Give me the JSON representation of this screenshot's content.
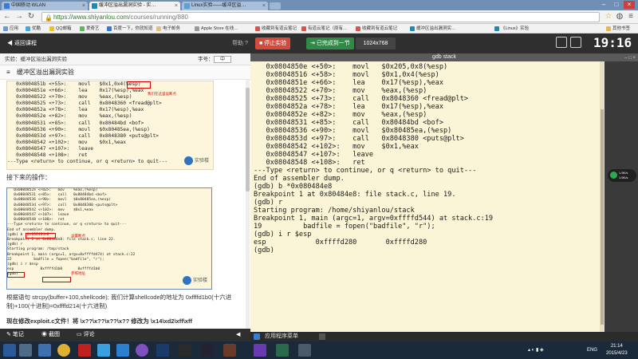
{
  "browser": {
    "tabs": [
      {
        "label": "中国移动 WLAN",
        "active": false
      },
      {
        "label": "缓冲区溢出漏洞实验 - 实…",
        "active": true
      },
      {
        "label": "Linux实验——缓冲区溢…",
        "active": false
      }
    ],
    "url_host": "https://www.shiyanlou.com",
    "url_path": "/courses/running/880",
    "bookmarks": [
      "应用",
      "优酷",
      "QQ邮箱",
      "爱奇艺",
      "百度一下，你就知道",
      "电子邮务",
      "Apple Store 在线…",
      "收藏到有道云笔记",
      "有道云笔记（原有…",
      "收藏到有道云笔记",
      "缓冲区溢出漏洞实…",
      "《Linux》实验",
      "其他书签"
    ]
  },
  "toolbar": {
    "back_label": "返回课程",
    "help_label": "帮助",
    "stop_label": "停止实验",
    "next_label": "已完成到一节",
    "resolution": "1024x768",
    "clock": "19:16"
  },
  "left_panel": {
    "header": "实验：缓冲区溢出漏洞实验",
    "font_label": "字号：",
    "font_value": "中",
    "section_title": "缓冲区溢出漏洞实验",
    "shot1_lines": [
      "   0x0804851b <+55>:    movl   $0x1,0x4(%esp)",
      "   0x0804851e <+66>:    lea    0x17(%esp),%eax",
      "   0x08048522 <+70>:    mov    %eax,(%esp)",
      "   0x08048525 <+73>:    call   0x8048360 <fread@plt>",
      "   0x0804852a <+78>:    lea    0x17(%esp),%eax",
      "   0x0804852e <+82>:    mov    %eax,(%esp)",
      "   0x08048531 <+85>:    call   0x80484bd <bof>",
      "   0x08048536 <+90>:    movl   $0x80485ea,(%esp)",
      "   0x0804853d <+97>:    call   0x8048380 <puts@plt>",
      "   0x08048542 <+102>:   mov    $0x1,%eax",
      "   0x08048547 <+107>:   leave",
      "   0x08048548 <+108>:   ret",
      "---Type <return> to continue, or q <return> to quit---"
    ],
    "shot1_annot": "我们在这里设断点",
    "shot1_logo": "实验楼",
    "shot2_caption": "接下来的操作：",
    "shot2_lines": [
      "   0x0804852e <+82>:   mov    %eax,(%esp)",
      "   0x08048531 <+85>:   call   0x80484bd <bof>",
      "   0x08048536 <+90>:   movl   $0x80485ea,(%esp)",
      "   0x0804853d <+97>:   call   0x8048380 <puts@plt>",
      "   0x08048542 <+102>:  mov    $0x1,%eax",
      "   0x08048547 <+107>:  leave",
      "   0x08048548 <+108>:  ret",
      "---Type <return> to continue, or q <return> to quit---",
      "End of assembler dump.",
      "(gdb) b *0x080484e8",
      "Breakpoint 1 at 0x80484e8: file stack.c, line 22.",
      "(gdb) r",
      "Starting program: /tmp/stack",
      "",
      "Breakpoint 1, main (argc=1, argv=0xffffd474) at stack.c:22",
      "22          badfile = fopen(\"badfile\", \"r\");",
      "(gdb) i r $esp",
      "esp            0xffffd1b0       0xffffd1b0",
      "(gdb) "
    ],
    "shot2_annot1": "设置断点",
    "shot2_annot2": "esp",
    "shot2_annot3": "参照地址",
    "para1": "根据语句 strcpy(buffer+100,shellcode); 我们计算shellcode的地址为 0xffffd1b0(十六进制)+100(十进制)=0xffffd214(十六进制)",
    "para2": "现在修改exploit.c文件！将 \\x??\\x??\\x??\\x?? 修改为 \\x14\\xd2\\xff\\xff",
    "footer": [
      "笔记",
      "截图",
      "评论"
    ]
  },
  "terminal": {
    "title": "gdb stack",
    "lines": [
      "   0x0804850e <+50>:    movl   $0x205,0x8(%esp)",
      "   0x08048516 <+58>:    movl   $0x1,0x4(%esp)",
      "   0x0804851e <+66>:    lea    0x17(%esp),%eax",
      "   0x08048522 <+70>:    mov    %eax,(%esp)",
      "   0x08048525 <+73>:    call   0x8048360 <fread@plt>",
      "   0x0804852a <+78>:    lea    0x17(%esp),%eax",
      "   0x0804852e <+82>:    mov    %eax,(%esp)",
      "   0x08048531 <+85>:    call   0x80484bd <bof>",
      "   0x08048536 <+90>:    movl   $0x80485ea,(%esp)",
      "   0x0804853d <+97>:    call   0x8048380 <puts@plt>",
      "   0x08048542 <+102>:   mov    $0x1,%eax",
      "   0x08048547 <+107>:   leave",
      "   0x08048548 <+108>:   ret",
      "---Type <return> to continue, or q <return> to quit---",
      "End of assembler dump.",
      "(gdb) b *0x080484e8",
      "Breakpoint 1 at 0x80484e8: file stack.c, line 19.",
      "(gdb) r",
      "Starting program: /home/shiyanlou/stack",
      "",
      "Breakpoint 1, main (argc=1, argv=0xffffd544) at stack.c:19",
      "19          badfile = fopen(\"badfile\", \"r\");",
      "(gdb) i r $esp",
      "esp            0xffffd280       0xffffd280",
      "(gdb) "
    ],
    "app_menu": "应用程序菜单",
    "net_up": "1.5K/s",
    "net_down": "1.5K/s"
  },
  "taskbar": {
    "ime": "ENG",
    "time": "21:14",
    "date": "2015/4/23"
  }
}
